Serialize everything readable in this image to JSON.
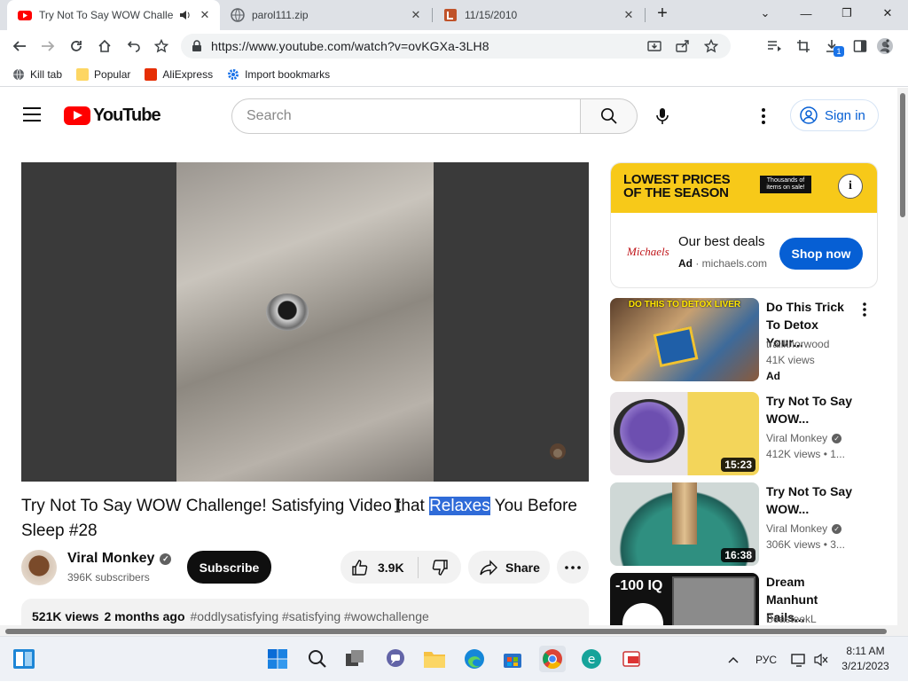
{
  "browser": {
    "tabs": [
      {
        "title": "Try Not To Say WOW Challenge!",
        "active": true
      },
      {
        "title": "parol111.zip",
        "active": false
      },
      {
        "title": "11/15/2010",
        "active": false
      }
    ],
    "new_tab": "+",
    "window_controls": {
      "dropdown": "⌄",
      "minimize": "—",
      "maximize": "❐",
      "close": "✕"
    },
    "url": "https://www.youtube.com/watch?v=ovKGXa-3LH8",
    "downloads_badge": "1",
    "bookmarks": [
      "Kill tab",
      "Popular",
      "AliExpress",
      "Import bookmarks"
    ]
  },
  "youtube": {
    "logo_text": "YouTube",
    "search_placeholder": "Search",
    "sign_in": "Sign in",
    "video": {
      "title_before": "Try Not To Say WOW Challenge! Satisfying Video that ",
      "title_highlight": "Relaxes",
      "title_after": " You Before Sleep #28",
      "channel": "Viral Monkey",
      "subscribers": "396K subscribers",
      "subscribe": "Subscribe",
      "likes": "3.9K",
      "share": "Share",
      "views": "521K views",
      "age": "2 months ago",
      "hashtags": "#oddlysatisfying #satisfying #wowchallenge"
    },
    "ad": {
      "banner_headline_1": "LOWEST PRICES",
      "banner_headline_2": "OF THE SEASON",
      "banner_pill": "Thousands of items on sale!",
      "info": "i",
      "advertiser_logo": "Michaels",
      "headline": "Our best deals",
      "badge": "Ad",
      "domain": "michaels.com",
      "cta": "Shop now"
    },
    "recommendations": [
      {
        "title": "Do This Trick To Detox Your...",
        "channel": "traliknorwood",
        "views": "41K views",
        "badge": "Ad",
        "thumb_caption": "DO THIS TO DETOX LIVER",
        "duration": ""
      },
      {
        "title": "Try Not To Say WOW...",
        "channel": "Viral Monkey",
        "views": "412K views",
        "age": "1...",
        "duration": "15:23"
      },
      {
        "title": "Try Not To Say WOW...",
        "channel": "Viral Monkey",
        "views": "306K views",
        "age": "3...",
        "duration": "16:38"
      },
      {
        "title": "Dream Manhunt Fails...",
        "channel": "BeasteekL",
        "thumb_caption": "-100 IQ",
        "duration": ""
      }
    ]
  },
  "taskbar": {
    "language": "РУС",
    "time": "8:11 AM",
    "date": "3/21/2023"
  },
  "colors": {
    "yt_red": "#ff0000",
    "link_blue": "#065fd4",
    "ad_yellow": "#f7c919",
    "highlight": "#2f6bd8"
  }
}
